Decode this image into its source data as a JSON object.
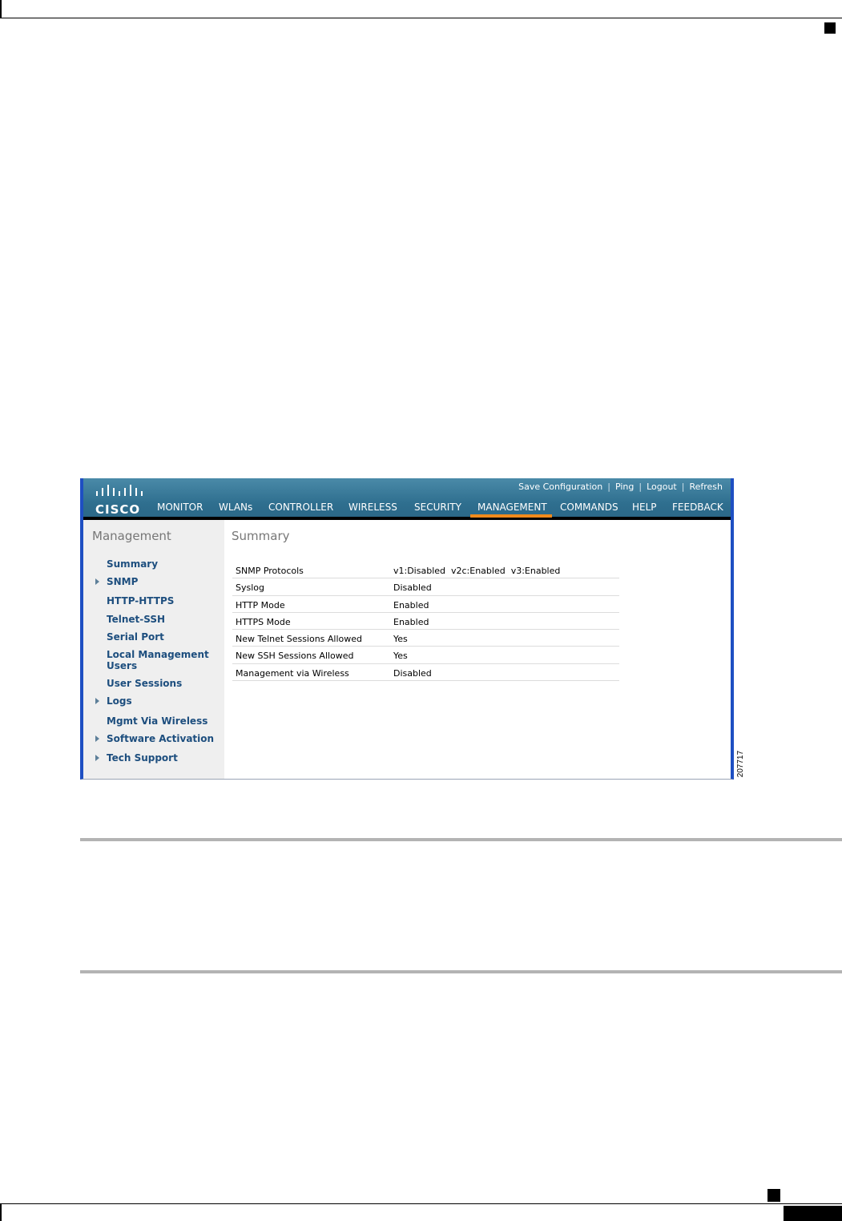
{
  "header": {
    "brand": "CISCO",
    "util_links": [
      "Save Configuration",
      "Ping",
      "Logout",
      "Refresh"
    ],
    "nav": [
      "MONITOR",
      "WLANs",
      "CONTROLLER",
      "WIRELESS",
      "SECURITY",
      "MANAGEMENT",
      "COMMANDS",
      "HELP",
      "FEEDBACK"
    ],
    "active_nav": "MANAGEMENT"
  },
  "sidebar": {
    "title": "Management",
    "items": [
      {
        "label": "Summary",
        "expandable": false
      },
      {
        "label": "SNMP",
        "expandable": true
      },
      {
        "label": "HTTP-HTTPS",
        "expandable": false
      },
      {
        "label": "Telnet-SSH",
        "expandable": false
      },
      {
        "label": "Serial Port",
        "expandable": false
      },
      {
        "label": "Local Management",
        "expandable": false
      },
      {
        "label": "Users",
        "expandable": false
      },
      {
        "label": "User Sessions",
        "expandable": false
      },
      {
        "label": "Logs",
        "expandable": true
      },
      {
        "label": "Mgmt Via Wireless",
        "expandable": false
      },
      {
        "label": "Software Activation",
        "expandable": true
      },
      {
        "label": "Tech Support",
        "expandable": true
      }
    ]
  },
  "main": {
    "title": "Summary",
    "rows": [
      {
        "key": "SNMP Protocols",
        "value": "v1:Disabled  v2c:Enabled  v3:Enabled"
      },
      {
        "key": "Syslog",
        "value": "Disabled"
      },
      {
        "key": "HTTP Mode",
        "value": "Enabled"
      },
      {
        "key": "HTTPS Mode",
        "value": "Enabled"
      },
      {
        "key": "New Telnet Sessions Allowed",
        "value": "Yes"
      },
      {
        "key": "New SSH Sessions Allowed",
        "value": "Yes"
      },
      {
        "key": "Management via Wireless",
        "value": "Disabled"
      }
    ]
  },
  "figure_number": "207717",
  "colors": {
    "header": "#2f6f8f",
    "active_tab": "#f08a1c",
    "frame": "#1e4fc2",
    "sidebar_link": "#1d4e7e"
  }
}
